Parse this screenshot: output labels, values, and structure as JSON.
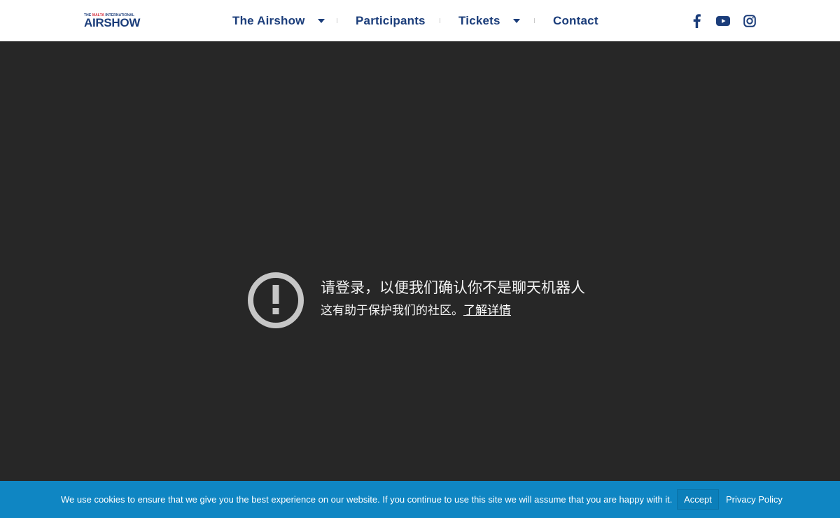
{
  "colors": {
    "brand_navy": "#1b3d7a",
    "brand_red": "#d42b3a",
    "page_background": "#272727",
    "cookie_bar": "#0f86c3"
  },
  "header": {
    "logo": {
      "small_part1": "THE",
      "small_part2": "MALTA",
      "small_part3": "INTERNATIONAL",
      "main": "AIRSHOW"
    },
    "nav": [
      {
        "label": "The Airshow",
        "has_dropdown": true,
        "icon": "chevron-down-icon"
      },
      {
        "label": "Participants",
        "has_dropdown": false
      },
      {
        "label": "Tickets",
        "has_dropdown": true,
        "icon": "chevron-down-icon"
      },
      {
        "label": "Contact",
        "has_dropdown": false
      }
    ],
    "social": [
      "facebook-icon",
      "youtube-icon",
      "instagram-icon"
    ]
  },
  "notice": {
    "icon": "alert-icon",
    "title": "请登录，以便我们确认你不是聊天机器人",
    "subtitle": "这有助于保护我们的社区。",
    "learn_more": "了解详情"
  },
  "cookie_bar": {
    "text": "We use cookies to ensure that we give you the best experience on our website. If you continue to use this site we will assume that you are happy with it.",
    "accept_label": "Accept",
    "privacy_label": "Privacy Policy"
  }
}
